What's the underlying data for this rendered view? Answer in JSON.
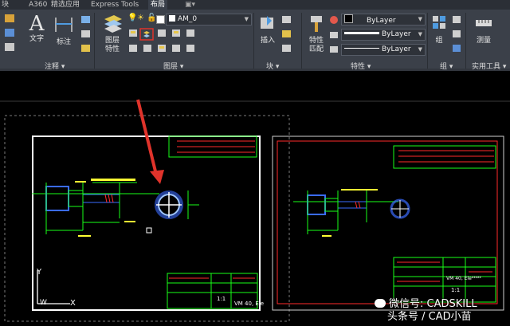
{
  "tabs": [
    "块",
    "A360",
    "精选应用",
    "Express Tools",
    "布局"
  ],
  "active_tab": "布局",
  "ribbon": {
    "panels": {
      "annotation": "注释",
      "layers": "图层",
      "block": "块",
      "properties": "特性",
      "groups": "组",
      "utilities": "实用工具"
    },
    "buttons": {
      "text": "文字",
      "dimension": "标注",
      "layer_properties_line1": "图层",
      "layer_properties_line2": "特性",
      "insert": "插入",
      "match_properties_line1": "特性",
      "match_properties_line2": "匹配",
      "group": "组",
      "measure": "测量"
    },
    "layer_combo": "AM_0",
    "color_combo": "ByLayer",
    "linetype_combo": "ByLayer",
    "lineweight_combo": "ByLayer"
  },
  "drawing": {
    "ucs_y": "Y",
    "ucs_w": "W",
    "ucs_x": "X",
    "scale_left": "1:1",
    "scale_right": "1:1",
    "title_left": "VM 40, Ele",
    "title_right": "VM 40, Ele²²²²²"
  },
  "watermark": {
    "line1": "微信号: CADSKILL",
    "line2": "头条号 / CAD小苗"
  },
  "colors": {
    "ribbon_bg": "#3b4049",
    "drawing_green": "#19ff19",
    "drawing_red": "#ff2a2a",
    "drawing_yellow": "#ffff33",
    "drawing_blue": "#3a6bff",
    "arrow_red": "#e0332b"
  }
}
